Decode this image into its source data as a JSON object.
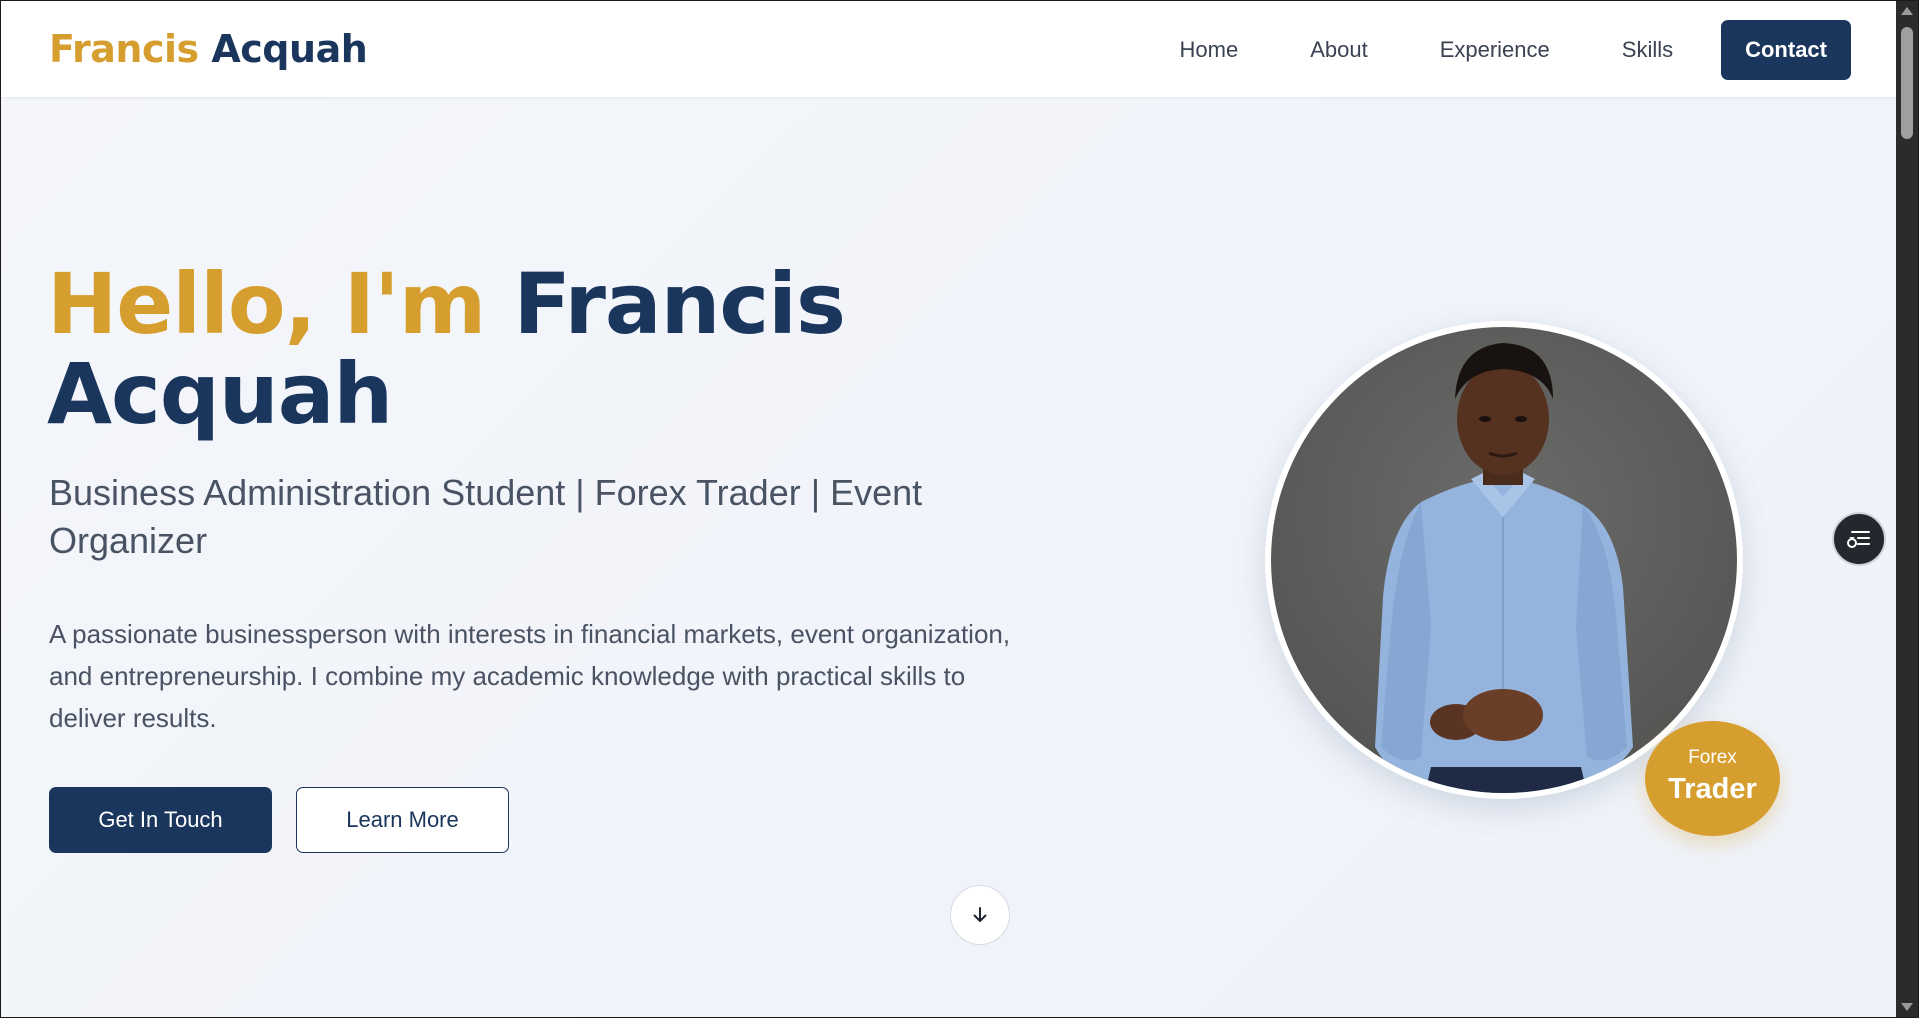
{
  "nav": {
    "logo_first": "Francis",
    "logo_last": "Acquah",
    "links": [
      "Home",
      "About",
      "Experience",
      "Skills"
    ],
    "contact_label": "Contact"
  },
  "hero": {
    "greeting": "Hello, I'm",
    "name": "Francis Acquah",
    "subtitle": "Business Administration Student | Forex Trader | Event Organizer",
    "description": "A passionate businessperson with interests in financial markets, event organization, and entrepreneurship. I combine my academic knowledge with practical skills to deliver results.",
    "primary_button": "Get In Touch",
    "secondary_button": "Learn More"
  },
  "badge": {
    "small": "Forex",
    "big": "Trader"
  },
  "icons": {
    "scroll_down": "arrow-down-icon",
    "fab": "reader-menu-icon"
  },
  "colors": {
    "brand_gold": "#d69e2e",
    "brand_navy": "#1a365d"
  }
}
